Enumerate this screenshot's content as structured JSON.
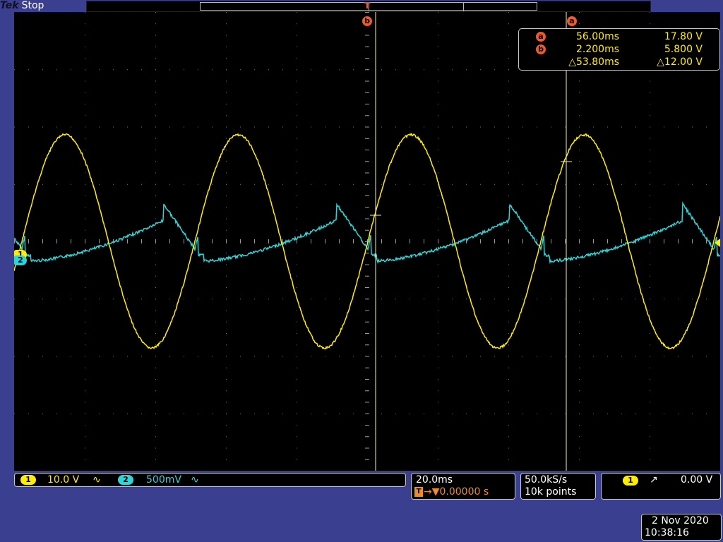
{
  "header": {
    "brand": "Tek",
    "acq_state": "Stop"
  },
  "trigger_marker_label": "T",
  "cursors": {
    "a_label": "a",
    "b_label": "b",
    "readout": {
      "a": {
        "label": "a",
        "time": "56.00ms",
        "volts": "17.80 V"
      },
      "b": {
        "label": "b",
        "time": "2.200ms",
        "volts": "5.800 V"
      },
      "delta": {
        "time": "△53.80ms",
        "volts": "△12.00 V"
      }
    }
  },
  "channels": [
    {
      "num": "1",
      "scale": "10.0 V",
      "coupling": "∿",
      "color": "#ffee00"
    },
    {
      "num": "2",
      "scale": "500mV",
      "coupling": "∿",
      "color": "#2fd4d8"
    }
  ],
  "horizontal": {
    "time_per_div": "20.0ms",
    "trigger_position_icon": "T",
    "trigger_position": "→▼0.00000 s"
  },
  "acquisition": {
    "sample_rate": "50.0kS/s",
    "record_length": "10k points"
  },
  "trigger": {
    "source": "1",
    "slope_icon": "rising-edge-icon",
    "slope_glyph": "↗",
    "level": "0.00 V"
  },
  "datetime": {
    "date": "2 Nov 2020",
    "time": "10:38:16"
  },
  "colors": {
    "ch1": "#ffee00",
    "ch2": "#2fd4d8",
    "cursor_badge": "#ee5a2a",
    "frame": "#3b3f8f"
  },
  "waveforms": {
    "ch1": {
      "type": "sine",
      "amplitude_divs": 3.0,
      "period_ms": 49,
      "phase_ms_zero_crossing_rising": 2.2
    },
    "ch2": {
      "type": "half-rectified-charge",
      "peak_divs": 0.95,
      "period_ms": 49
    }
  }
}
